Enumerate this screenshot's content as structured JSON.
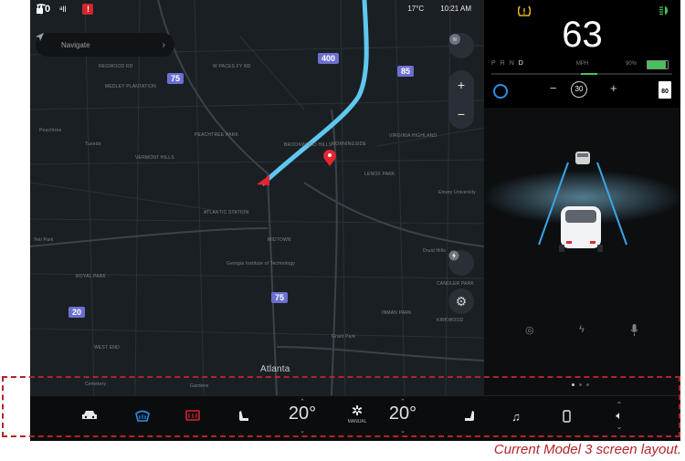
{
  "status": {
    "icons": [
      "lock-icon",
      "profile-icon",
      "signal-icon",
      "alert-icon",
      "tesla-logo"
    ],
    "signal_label": "ᵃll",
    "profile_glyph": "0",
    "alert_glyph": "!",
    "temperature": "17°C",
    "time": "10:21 AM"
  },
  "navigate": {
    "label": "Navigate",
    "icon": "navigate-arrow-icon"
  },
  "map": {
    "city_label": "Atlanta",
    "highway_shields": [
      "400",
      "85",
      "75",
      "75",
      "20"
    ],
    "place_labels": [
      "REGWOOD RD",
      "W PACES FY RD",
      "MEDLEY PLANTATION",
      "Peachtree",
      "Tuxedo",
      "VERMONT HILLS",
      "PEACHTREE PARK",
      "BROOKWOOD HILLS",
      "MORNINGSIDE",
      "VIRGINIA HIGHLAND",
      "LENOX PARK",
      "Emory University",
      "Georgia Institute of Technology",
      "MIDTOWN",
      "ATLANTIC STATION",
      "INMAN PARK",
      "ROYAL PARK",
      "WEST END",
      "Cemetery",
      "Gardens",
      "CANDLER PARK",
      "KIRKWOOD",
      "Druid Hills",
      "Yeti Park",
      "Grant Park"
    ]
  },
  "panel": {
    "speed": "63",
    "speed_unit": "MPH",
    "gears": [
      "P",
      "R",
      "N",
      "D"
    ],
    "active_gear": "D",
    "battery_pct": "90%",
    "battery_level": 0.9,
    "set_speed": "30",
    "speed_limit": "80",
    "power_level": 0.09,
    "bottom_icons": [
      "autopilot-icon",
      "charge-icon",
      "microphone-icon"
    ],
    "page_dots": 3,
    "active_dot": 0
  },
  "dock": {
    "left_temp": "20°",
    "right_temp": "20°",
    "fan_label": "MANUAL",
    "icons": [
      "car-icon",
      "front-defrost-icon",
      "rear-defrost-icon",
      "driver-seat-icon",
      "fan-icon",
      "passenger-seat-icon",
      "music-icon",
      "phone-icon",
      "volume-icon"
    ]
  },
  "caption": "Current Model 3 screen layout.",
  "colors": {
    "route": "#5ec8f0",
    "accent_blue": "#2f8ee8",
    "battery_green": "#45c25a",
    "warning_yellow": "#e8b321",
    "annotation_red": "#b3242a",
    "pin_red": "#e6262e"
  }
}
